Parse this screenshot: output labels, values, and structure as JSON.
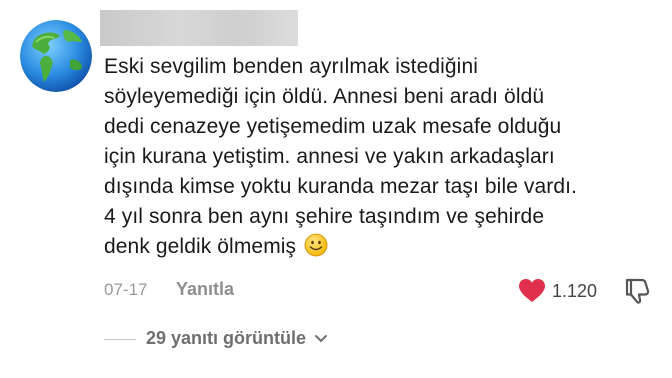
{
  "comment": {
    "lines": [
      "Eski sevgilim benden ayrılmak istediğini",
      "söyleyemediği için öldü. Annesi beni aradı öldü",
      "dedi cenazeye yetişemedim uzak mesafe olduğu",
      "için kurana yetiştim. annesi ve yakın arkadaşları",
      "dışında kimse yoktu kuranda mezar taşı bile vardı.",
      "4 yıl sonra ben aynı şehire taşındım ve şehirde",
      "denk geldik ölmemiş"
    ],
    "date": "07-17",
    "reply_label": "Yanıtla",
    "like_count": "1.120",
    "view_replies_label": "29 yanıtı görüntüle"
  },
  "colors": {
    "like_heart": "#e0304e",
    "text": "#1a1a1a",
    "muted": "#9a9a9a"
  },
  "icons": [
    "globe-avatar",
    "smiley-emoji",
    "heart-icon",
    "dislike-icon",
    "chevron-down-icon"
  ]
}
